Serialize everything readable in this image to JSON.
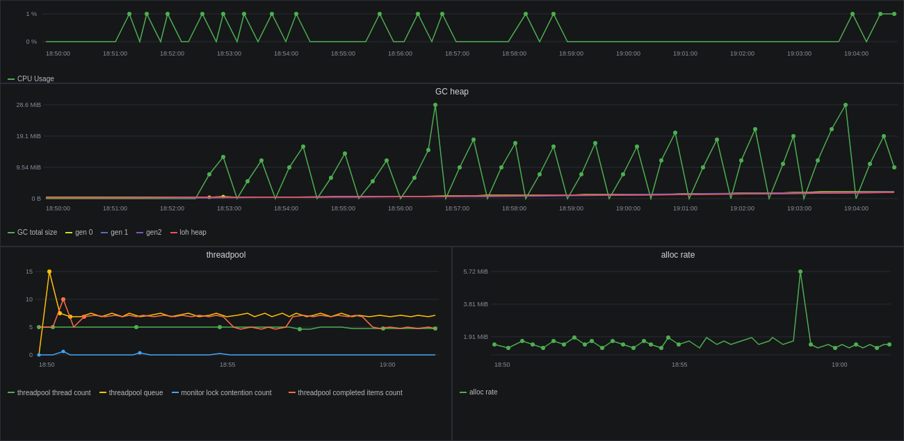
{
  "cpu_panel": {
    "title": "",
    "y_labels": [
      "1 %",
      "0 %"
    ],
    "x_labels": [
      "18:50:00",
      "18:51:00",
      "18:52:00",
      "18:53:00",
      "18:54:00",
      "18:55:00",
      "18:56:00",
      "18:57:00",
      "18:58:00",
      "18:59:00",
      "19:00:00",
      "19:01:00",
      "19:02:00",
      "19:03:00",
      "19:04:00"
    ],
    "legend": [
      {
        "label": "CPU Usage",
        "color": "#4caf50"
      }
    ]
  },
  "gc_panel": {
    "title": "GC heap",
    "y_labels": [
      "28.6 MiB",
      "19.1 MiB",
      "9.54 MiB",
      "0 B"
    ],
    "x_labels": [
      "18:50:00",
      "18:51:00",
      "18:52:00",
      "18:53:00",
      "18:54:00",
      "18:55:00",
      "18:56:00",
      "18:57:00",
      "18:58:00",
      "18:59:00",
      "19:00:00",
      "19:01:00",
      "19:02:00",
      "19:03:00",
      "19:04:00"
    ],
    "legend": [
      {
        "label": "GC total size",
        "color": "#4caf50"
      },
      {
        "label": "gen 0",
        "color": "#cddc39"
      },
      {
        "label": "gen 1",
        "color": "#5c6bc0"
      },
      {
        "label": "gen2",
        "color": "#7e57c2"
      },
      {
        "label": "loh heap",
        "color": "#ef5350"
      }
    ]
  },
  "threadpool_panel": {
    "title": "threadpool",
    "y_labels": [
      "15",
      "10",
      "5",
      "0"
    ],
    "x_labels": [
      "18:50",
      "18:55",
      "19:00"
    ],
    "legend": [
      {
        "label": "threadpool thread count",
        "color": "#4caf50"
      },
      {
        "label": "threadpool queue",
        "color": "#ffc107"
      },
      {
        "label": "monitor lock contention count",
        "color": "#42a5f5"
      },
      {
        "label": "threadpool completed items count",
        "color": "#ff7043"
      }
    ]
  },
  "allocrate_panel": {
    "title": "alloc rate",
    "y_labels": [
      "5.72 MiB",
      "3.81 MiB",
      "1.91 MiB",
      ""
    ],
    "x_labels": [
      "18:50",
      "18:55",
      "19:00"
    ],
    "legend": [
      {
        "label": "alloc rate",
        "color": "#4caf50"
      }
    ]
  }
}
